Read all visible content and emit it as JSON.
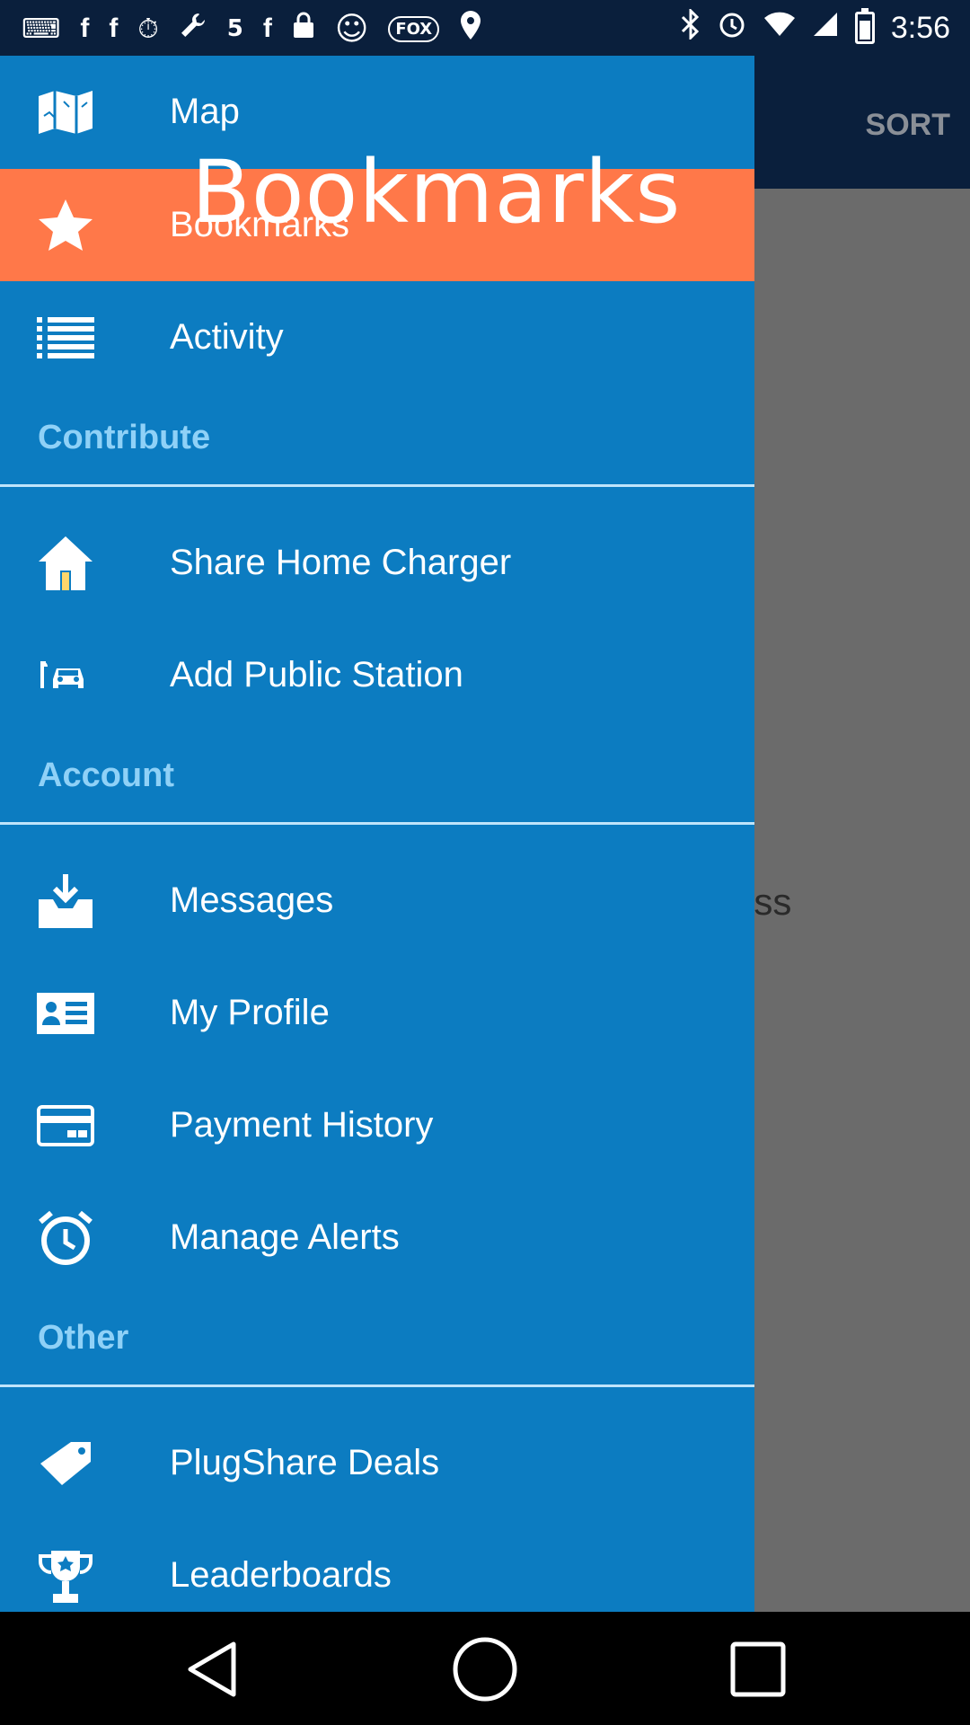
{
  "status_bar": {
    "time": "3:56",
    "left_icons": [
      "keyboard-icon",
      "facebook-icon",
      "facebook-icon",
      "timer-icon",
      "wrench-icon",
      "channel5-icon",
      "facebook-icon",
      "lock-icon",
      "smiley-icon",
      "fox-sports-icon",
      "location-icon"
    ],
    "left_glyphs": [
      "⌨",
      "f",
      "f",
      "⏱",
      "🔧",
      "5",
      "f",
      "🔒",
      "☺",
      "FOX",
      "⌖"
    ],
    "right_icons": [
      "bluetooth-icon",
      "alarm-icon",
      "wifi-icon",
      "signal-icon",
      "battery-icon"
    ],
    "right_glyphs": [
      "✱",
      "⏰",
      "◈",
      "◢"
    ]
  },
  "app_bar": {
    "sort_label": "SORT"
  },
  "background_text": "ess",
  "overlay_title": "Bookmarks",
  "drawer": {
    "items": [
      {
        "key": "map",
        "label": "Map",
        "icon": "map-icon"
      },
      {
        "key": "bookmarks",
        "label": "Bookmarks",
        "icon": "star-icon",
        "active": true
      },
      {
        "key": "activity",
        "label": "Activity",
        "icon": "list-icon"
      },
      {
        "key": "share_home_charger",
        "label": "Share Home Charger",
        "icon": "home-icon"
      },
      {
        "key": "add_public_station",
        "label": "Add Public Station",
        "icon": "ev-station-icon"
      },
      {
        "key": "messages",
        "label": "Messages",
        "icon": "inbox-download-icon"
      },
      {
        "key": "my_profile",
        "label": "My Profile",
        "icon": "profile-card-icon"
      },
      {
        "key": "payment_history",
        "label": "Payment History",
        "icon": "credit-card-icon"
      },
      {
        "key": "manage_alerts",
        "label": "Manage Alerts",
        "icon": "alarm-clock-icon"
      },
      {
        "key": "plugshare_deals",
        "label": "PlugShare Deals",
        "icon": "tag-icon"
      },
      {
        "key": "leaderboards",
        "label": "Leaderboards",
        "icon": "trophy-icon"
      }
    ],
    "sections": {
      "contribute": "Contribute",
      "account": "Account",
      "other": "Other"
    }
  },
  "colors": {
    "drawer_bg": "#0c7cc1",
    "active_bg": "#ff7849",
    "app_bar_bg": "#0a1f3c",
    "section_text": "#8fd1f7",
    "scrim": "#6b6b6b"
  },
  "nav_bar": {
    "buttons": [
      "back-icon",
      "home-icon",
      "recents-icon"
    ]
  }
}
